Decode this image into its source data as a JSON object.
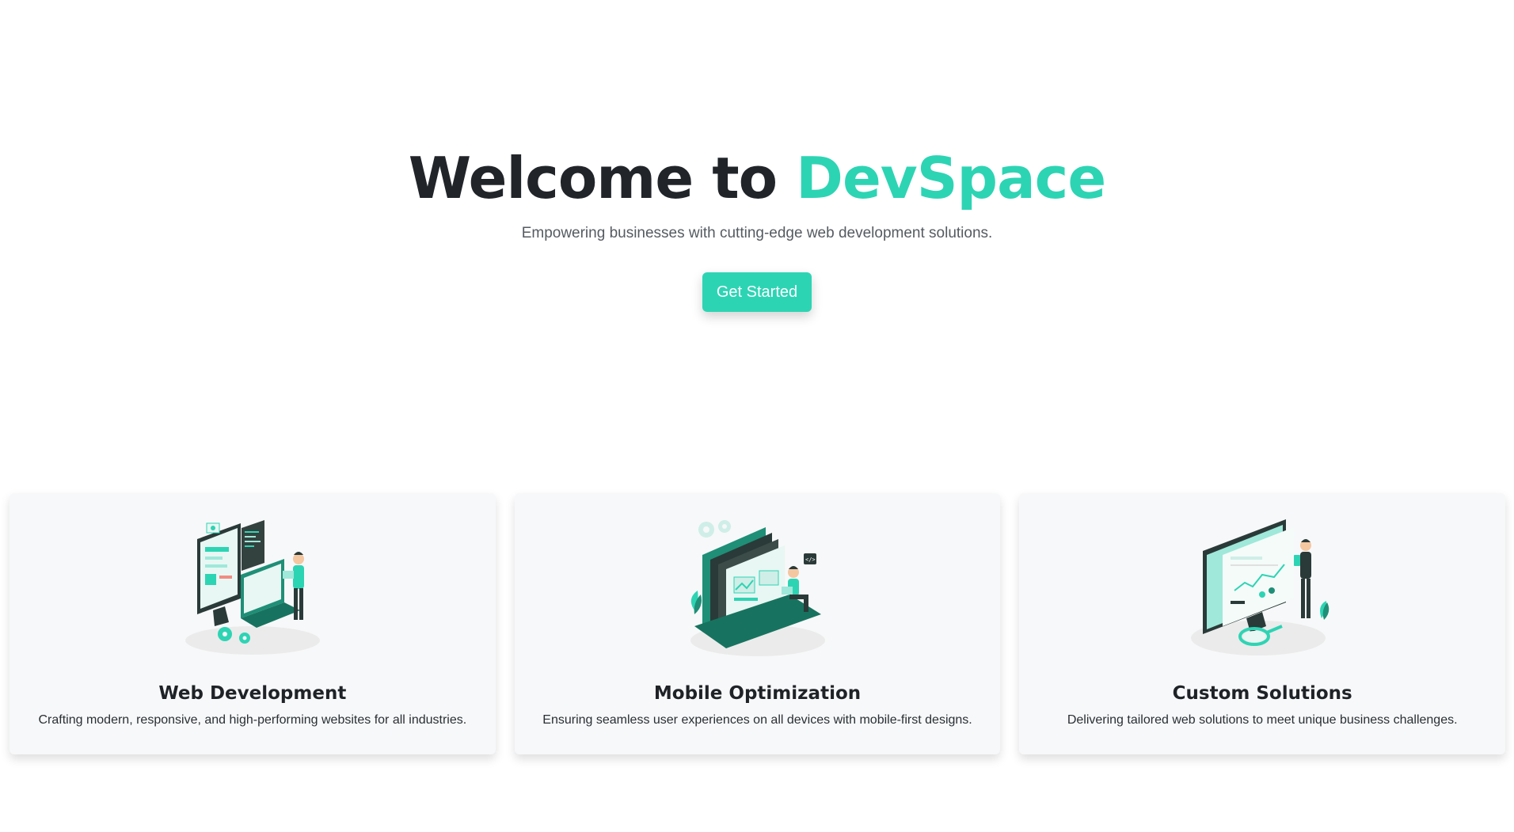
{
  "hero": {
    "title_prefix": "Welcome to ",
    "title_brand": "DevSpace",
    "subtitle": "Empowering businesses with cutting-edge web development solutions.",
    "cta_label": "Get Started"
  },
  "colors": {
    "accent": "#2dd4b4",
    "heading": "#212529",
    "card_bg": "#f7f8f9"
  },
  "services": [
    {
      "title": "Web Development",
      "description": "Crafting modern, responsive, and high-performing websites for all industries.",
      "illustration": "web-development-illustration"
    },
    {
      "title": "Mobile Optimization",
      "description": "Ensuring seamless user experiences on all devices with mobile-first designs.",
      "illustration": "mobile-optimization-illustration"
    },
    {
      "title": "Custom Solutions",
      "description": "Delivering tailored web solutions to meet unique business challenges.",
      "illustration": "custom-solutions-illustration"
    }
  ]
}
